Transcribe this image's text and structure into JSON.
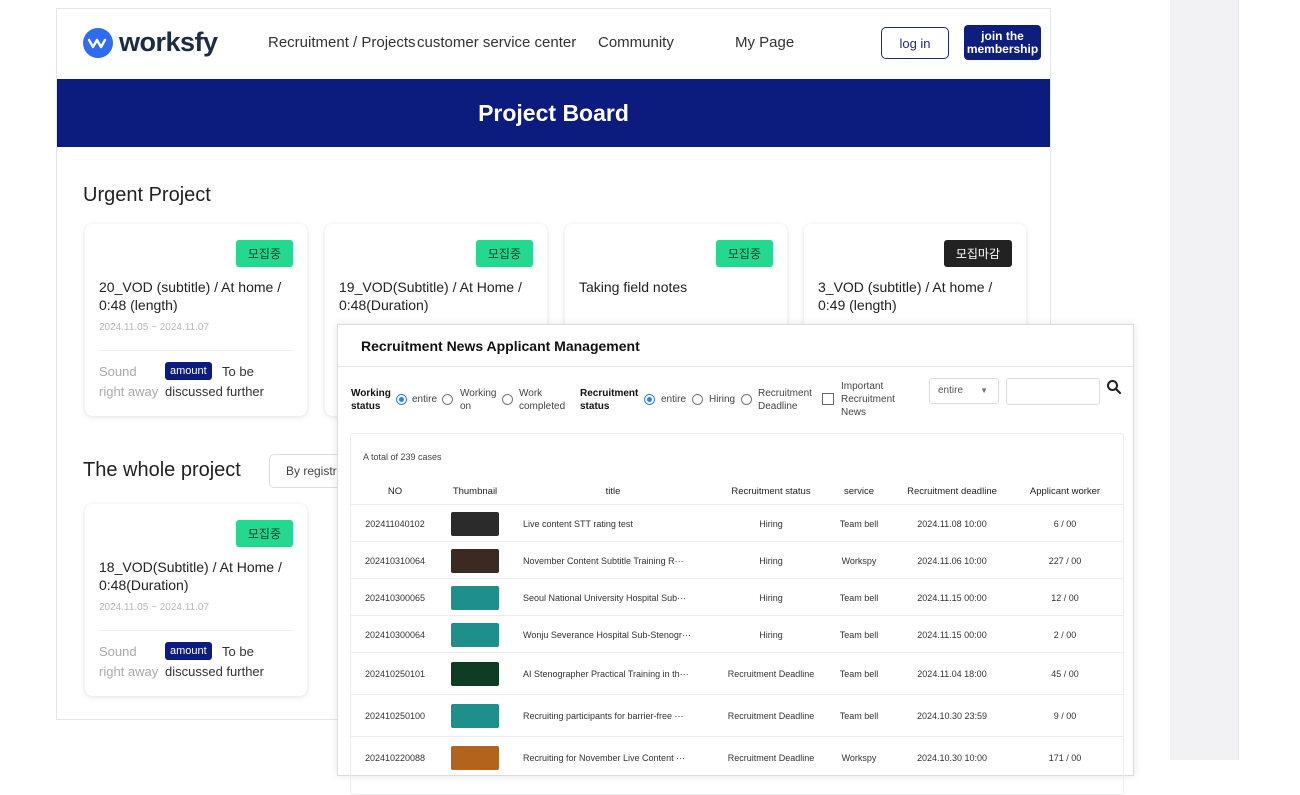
{
  "nav": {
    "logo_text": "worksfy",
    "links": [
      "Recruitment / Projects",
      "customer service center",
      "Community",
      "My Page"
    ],
    "login_label": "log in",
    "join_label": "join the membership"
  },
  "banner": {
    "title": "Project Board"
  },
  "urgent": {
    "title": "Urgent Project",
    "cards": [
      {
        "badge": "모집중",
        "status": "open",
        "title": "20_VOD (subtitle) / At home / 0:48 (length)",
        "date": "2024.11.05 ~ 2024.11.07",
        "sound": "Sound right away",
        "amount": "amount",
        "tbd": "To be discussed further"
      },
      {
        "badge": "모집중",
        "status": "open",
        "title": "19_VOD(Subtitle) / At Home / 0:48(Duration)",
        "date": "",
        "sound": "",
        "amount": "",
        "tbd": ""
      },
      {
        "badge": "모집중",
        "status": "open",
        "title": "Taking field notes",
        "date": "",
        "sound": "",
        "amount": "",
        "tbd": ""
      },
      {
        "badge": "모집마감",
        "status": "closed",
        "title": "3_VOD (subtitle) / At home / 0:49 (length)",
        "date": "",
        "sound": "",
        "amount": "",
        "tbd": ""
      }
    ]
  },
  "whole": {
    "title": "The whole project",
    "sort_label": "By registr",
    "cards": [
      {
        "badge": "모집중",
        "status": "open",
        "title": "18_VOD(Subtitle) / At Home / 0:48(Duration)",
        "date": "2024.11.05 ~ 2024.11.07",
        "sound": "Sound right away",
        "amount": "amount",
        "tbd": "To be discussed further"
      }
    ]
  },
  "panel": {
    "title": "Recruitment News Applicant Management",
    "filters": {
      "working_label": "Working status",
      "working_options": [
        "entire",
        "Working on",
        "Work completed"
      ],
      "recruit_label": "Recruitment status",
      "recruit_options": [
        "entire",
        "Hiring",
        "Recruitment Deadline"
      ],
      "important_label": "Important Recruitment News",
      "select_value": "entire",
      "search_value": ""
    },
    "total": "A total of 239 cases",
    "columns": [
      "NO",
      "Thumbnail",
      "title",
      "Recruitment status",
      "service",
      "Recruitment deadline",
      "Applicant worker"
    ],
    "rows": [
      {
        "no": "202411040102",
        "title": "Live content STT rating test",
        "status": "Hiring",
        "service": "Team bell",
        "deadline": "2024.11.08 10:00",
        "applicants": "6 / 00",
        "thumb_color": "#2b2b2b"
      },
      {
        "no": "202410310064",
        "title": "November Content Subtitle Training R···",
        "status": "Hiring",
        "service": "Workspy",
        "deadline": "2024.11.06 10:00",
        "applicants": "227 / 00",
        "thumb_color": "#3a2a22"
      },
      {
        "no": "202410300065",
        "title": "Seoul National University Hospital Sub···",
        "status": "Hiring",
        "service": "Team bell",
        "deadline": "2024.11.15 00:00",
        "applicants": "12 / 00",
        "thumb_color": "#1e8f8a"
      },
      {
        "no": "202410300064",
        "title": "Wonju Severance Hospital Sub-Stenogr···",
        "status": "Hiring",
        "service": "Team bell",
        "deadline": "2024.11.15 00:00",
        "applicants": "2 / 00",
        "thumb_color": "#1e8f8a"
      },
      {
        "no": "202410250101",
        "title": "AI Stenographer Practical Training in th···",
        "status": "Recruitment Deadline",
        "service": "Team bell",
        "deadline": "2024.11.04 18:00",
        "applicants": "45 / 00",
        "thumb_color": "#0f3d24"
      },
      {
        "no": "202410250100",
        "title": "Recruiting participants for barrier-free ···",
        "status": "Recruitment Deadline",
        "service": "Team bell",
        "deadline": "2024.10.30 23:59",
        "applicants": "9 / 00",
        "thumb_color": "#1e8f8a"
      },
      {
        "no": "202410220088",
        "title": "Recruiting for November Live Content ···",
        "status": "Recruitment Deadline",
        "service": "Workspy",
        "deadline": "2024.10.30 10:00",
        "applicants": "171 / 00",
        "thumb_color": "#b2641c"
      }
    ]
  }
}
